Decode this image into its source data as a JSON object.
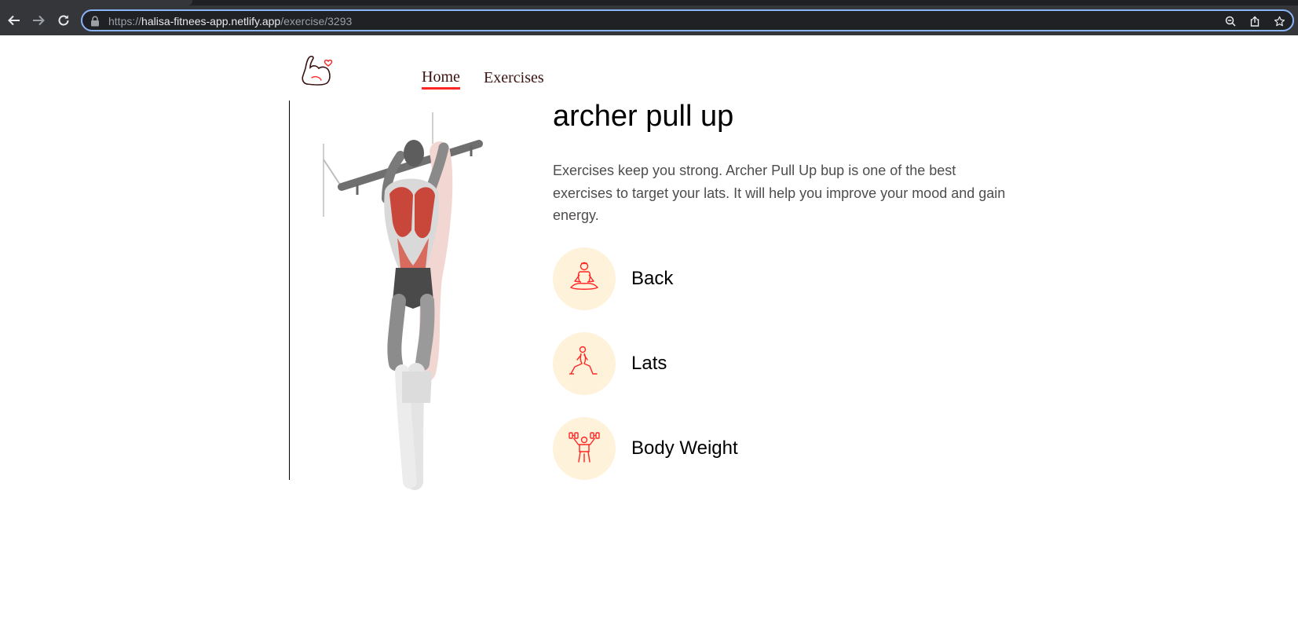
{
  "browser": {
    "url_scheme": "https://",
    "url_host": "halisa-fitnees-app.netlify.app",
    "url_path": "/exercise/3293",
    "icons": [
      "back-arrow-icon",
      "forward-arrow-icon",
      "reload-icon",
      "lock-icon",
      "zoom-icon",
      "share-icon",
      "bookmark-star-icon"
    ]
  },
  "nav": {
    "home_label": "Home",
    "exercises_label": "Exercises"
  },
  "exercise": {
    "name": "archer pull up",
    "description": "Exercises keep you strong. Archer Pull Up bup is one of the best exercises to target your lats. It will help you improve your mood and gain energy.",
    "details": [
      {
        "label": "Back",
        "icon": "meditation-pose-icon"
      },
      {
        "label": "Lats",
        "icon": "lunge-pose-icon"
      },
      {
        "label": "Body Weight",
        "icon": "dumbbell-lift-icon"
      }
    ]
  },
  "colors": {
    "accent": "#ff2625",
    "icon_bg": "#fff2db",
    "nav_text": "#3a1212",
    "description_text": "#4f4c4c"
  }
}
